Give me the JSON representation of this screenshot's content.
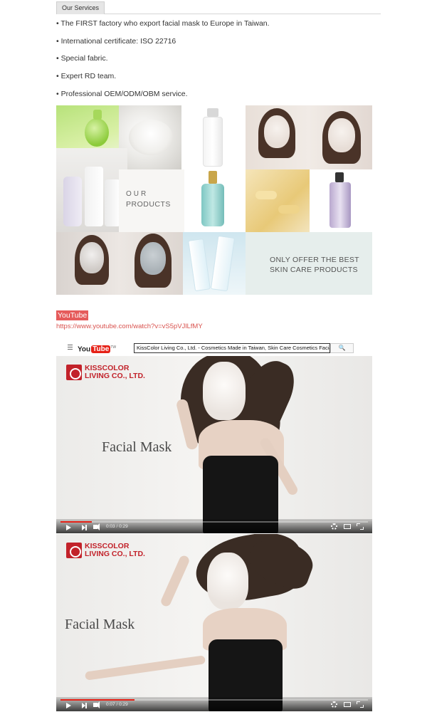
{
  "services": {
    "tab_label": "Our Services",
    "bullets": [
      "• The FIRST factory who export facial mask to Europe in Taiwan.",
      "• International certificate: ISO 22716",
      "• Special fabric.",
      "• Expert RD team.",
      "• Professional OEM/ODM/OBM service."
    ]
  },
  "collage": {
    "our_products_line1": "OUR",
    "our_products_line2": "PRODUCTS",
    "offer_line1": "ONLY OFFER THE BEST",
    "offer_line2": "SKIN CARE PRODUCTS"
  },
  "youtube": {
    "title": "YouTube",
    "link": "https://www.youtube.com/watch?v=vS5pVJlLfMY",
    "logo_you": "You",
    "logo_tube": "Tube",
    "logo_tm": "TW",
    "search_value": "KissColor Living Co., Ltd. - Cosmetics Made in Taiwan, Skin Care Cosmetics Facial M",
    "search_icon": "🔍",
    "accent_color": "#e62117"
  },
  "videos": [
    {
      "brand_line1": "KISSCOLOR",
      "brand_line2": "LIVING CO., LTD.",
      "title": "Facial Mask",
      "time": "0:03 / 0:29",
      "progress": 0.103
    },
    {
      "brand_line1": "KISSCOLOR",
      "brand_line2": "LIVING CO., LTD.",
      "title": "Facial Mask",
      "time": "0:07 / 0:29",
      "progress": 0.241
    }
  ]
}
